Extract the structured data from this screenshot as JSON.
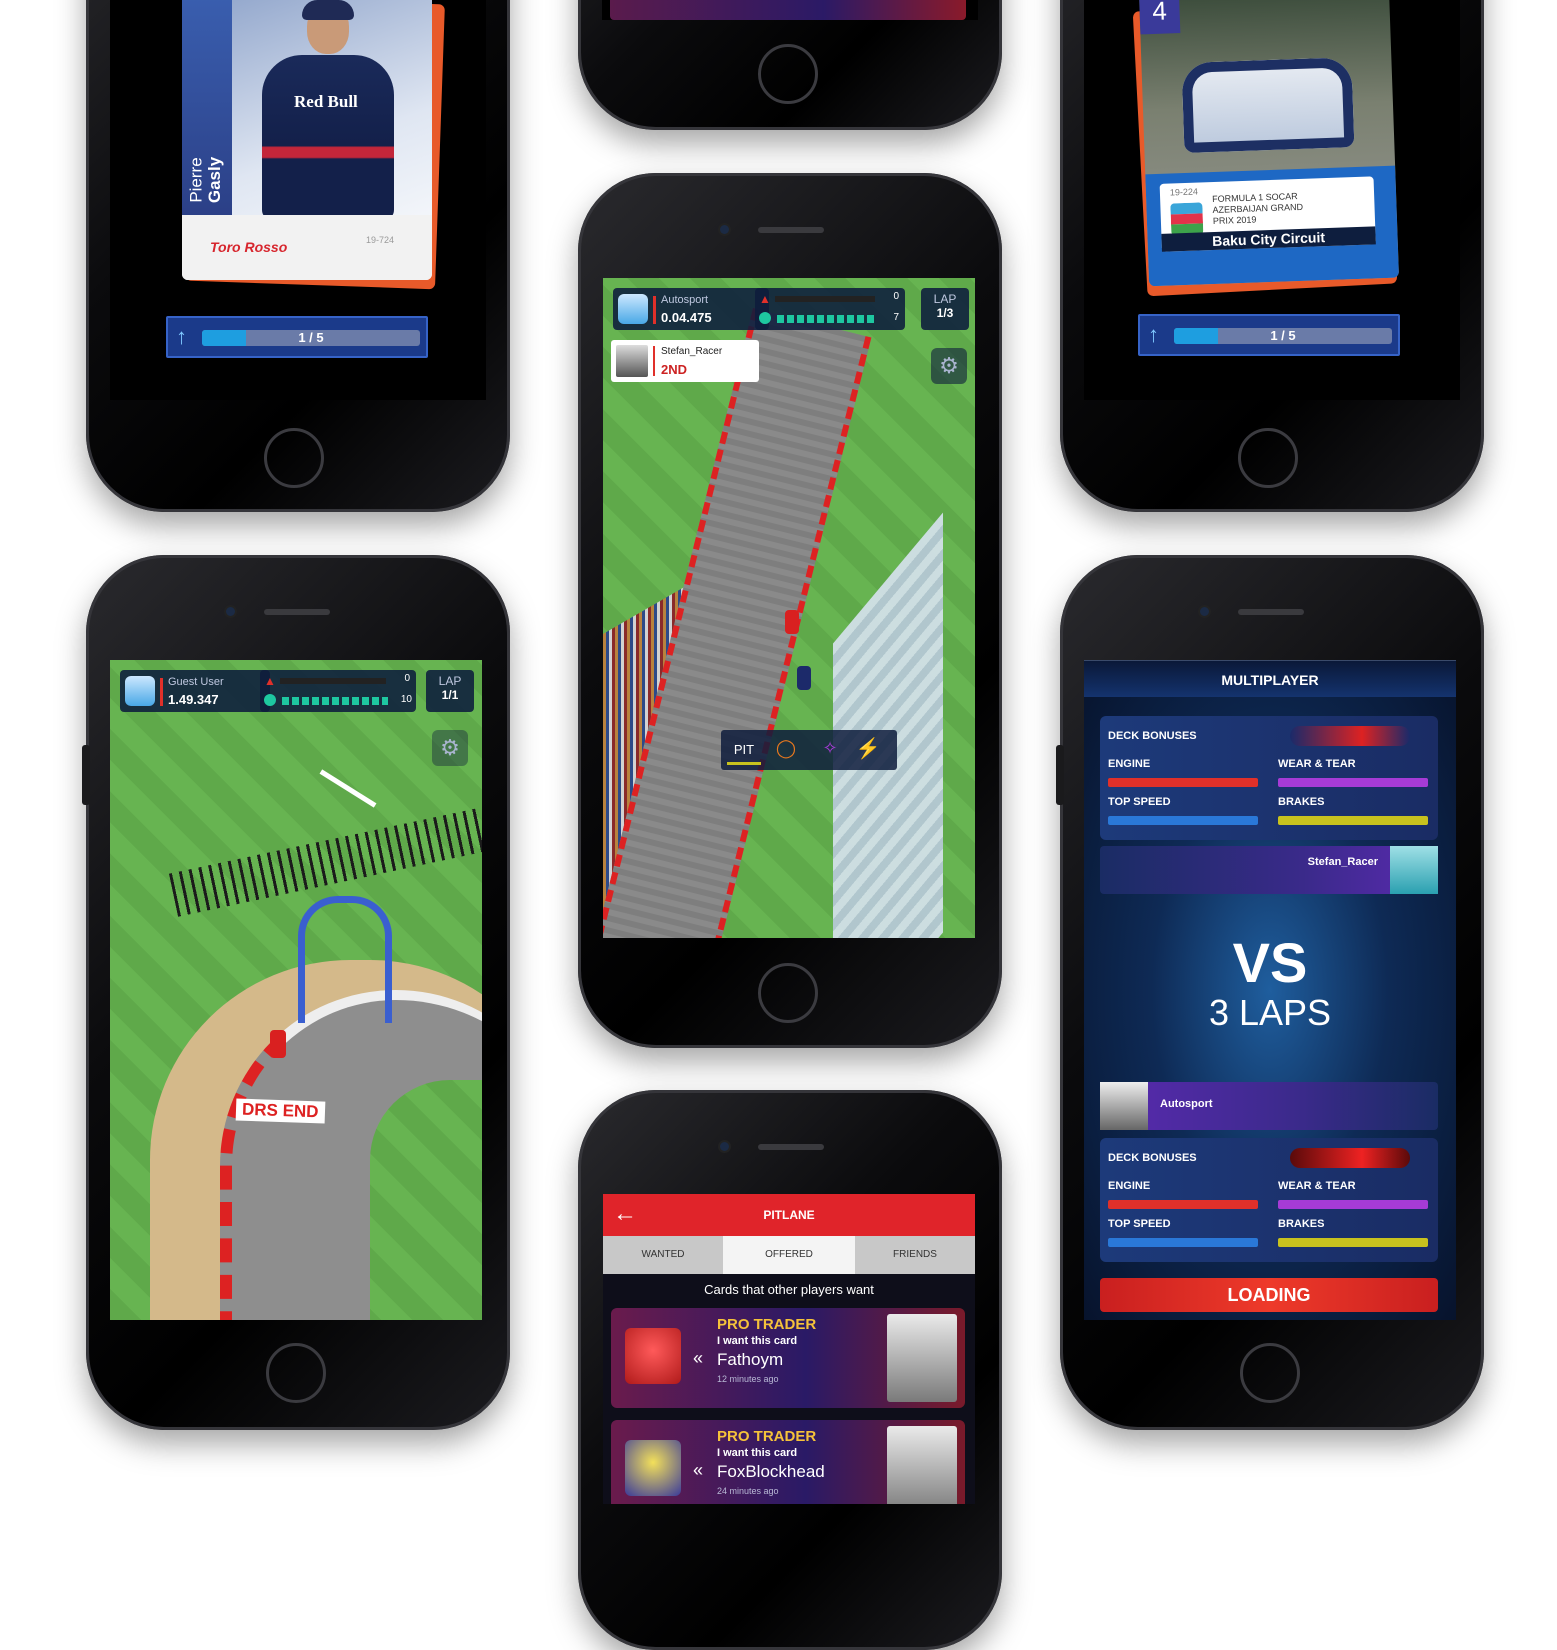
{
  "card1": {
    "first_name": "Pierre",
    "last_name": "Gasly",
    "sponsor": "Red Bull",
    "team": "Toro Rosso",
    "card_number": "19-724",
    "progress_text": "1 / 5",
    "progress": 0.2
  },
  "card2": {
    "number": "4",
    "card_number": "19-224",
    "race_name_line1": "FORMULA 1 SOCAR",
    "race_name_line2": "AZERBAIJAN GRAND",
    "race_name_line3": "PRIX 2019",
    "circuit": "Baku City Circuit",
    "progress_text": "1 / 5",
    "progress": 0.2
  },
  "race_top": {
    "player_name": "Autosport",
    "lap_time": "0.04.475",
    "lap_label": "LAP",
    "lap_value": "1/3",
    "warn_count": "0",
    "boost_count": "7",
    "opponent_name": "Stefan_Racer",
    "opponent_position": "2ND",
    "pit_label": "PIT"
  },
  "race_left": {
    "player_name": "Guest User",
    "lap_time": "1.49.347",
    "lap_label": "LAP",
    "lap_value": "1/1",
    "warn_count": "0",
    "boost_count": "10",
    "track_sign": "DRS END"
  },
  "multiplayer": {
    "title": "MULTIPLAYER",
    "deck1": {
      "heading": "DECK BONUSES",
      "engine": "ENGINE",
      "wear": "WEAR & TEAR",
      "top_speed": "TOP SPEED",
      "brakes": "BRAKES"
    },
    "opponent": "Stefan_Racer",
    "vs": "VS",
    "laps": "3 LAPS",
    "player": "Autosport",
    "deck2": {
      "heading": "DECK BONUSES",
      "engine": "ENGINE",
      "wear": "WEAR & TEAR",
      "top_speed": "TOP SPEED",
      "brakes": "BRAKES"
    },
    "loading": "LOADING",
    "colors": {
      "engine": "#e0302a",
      "wear": "#a63bd6",
      "top_speed": "#2a78d8",
      "brakes": "#c8c21e"
    }
  },
  "pitlane": {
    "title": "PITLANE",
    "tabs": [
      "WANTED",
      "OFFERED",
      "FRIENDS"
    ],
    "active_tab": "OFFERED",
    "subtitle": "Cards that other players want",
    "trades": [
      {
        "badge": "PRO TRADER",
        "request": "I want this card",
        "user": "Fathoym",
        "time": "12 minutes ago"
      },
      {
        "badge": "PRO TRADER",
        "request": "I want this card",
        "user": "FoxBlockhead",
        "time": "24 minutes ago"
      }
    ]
  }
}
